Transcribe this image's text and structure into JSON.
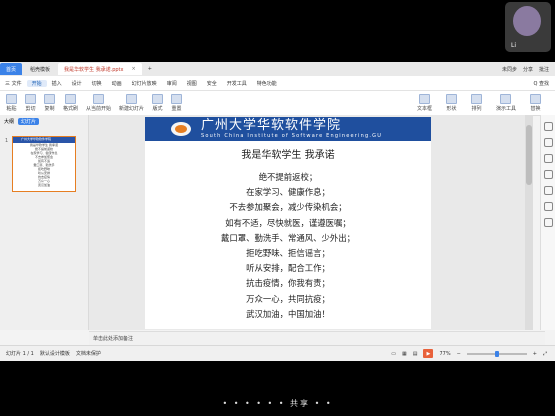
{
  "video_tile": {
    "name_label": "Li"
  },
  "tabs": [
    {
      "label": "首页"
    },
    {
      "label": "稻壳模板"
    },
    {
      "label": "我是华软学生 我承诺.pptx"
    }
  ],
  "title_right": [
    "未同步",
    "分享",
    "批注"
  ],
  "menu": {
    "file": "三 文件",
    "items": [
      "开始",
      "插入",
      "设计",
      "切换",
      "动画",
      "幻灯片放映",
      "审阅",
      "视图",
      "安全",
      "开发工具",
      "特色功能"
    ],
    "search": "Q 查找",
    "active_index": 0
  },
  "toolbar": {
    "groups": [
      "粘贴",
      "剪切",
      "复制",
      "格式刷",
      "从当前开始",
      "新建幻灯片",
      "版式",
      "重置"
    ],
    "right": [
      "文本框",
      "形状",
      "排列",
      "演示工具",
      "替换"
    ]
  },
  "sidebar": {
    "tabs": [
      "大纲",
      "幻灯片"
    ],
    "active_tab": 1,
    "thumb_number": "1",
    "thumb_header": "广州大学华软软件学院",
    "thumb_lines": [
      "我是华软学生 我承诺",
      "绝不提前返校",
      "在家学习、健康作息",
      "不去参加聚会",
      "如有不适",
      "戴口罩、勤洗手",
      "拒吃野味",
      "听从安排",
      "抗击疫情",
      "万众一心",
      "武汉加油"
    ]
  },
  "slide": {
    "banner_cn": "广州大学华软软件学院",
    "banner_en": "South China Institute of Software Engineering.GU",
    "title": "我是华软学生 我承诺",
    "lines": [
      "绝不提前返校；",
      "在家学习、健康作息；",
      "不去参加聚会，减少传染机会；",
      "如有不适，尽快就医，谨遵医嘱；",
      "戴口罩、勤洗手、常通风、少外出；",
      "拒吃野味、拒信谣言；",
      "听从安排，配合工作；",
      "抗击疫情，你我有责；",
      "万众一心，共同抗疫；",
      "武汉加油，中国加油！"
    ]
  },
  "notes": {
    "placeholder": "单击此处添加备注"
  },
  "status": {
    "slide_counter": "幻灯片 1 / 1",
    "template": "默认设计模板",
    "protection": "文档未保护",
    "zoom": "77%"
  },
  "bottom_overlay": "• • • • • • 共享 • •"
}
